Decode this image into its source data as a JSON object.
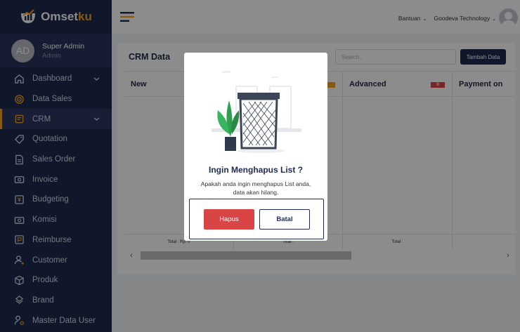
{
  "app": {
    "logo_text": "Omset",
    "logo_accent": "ku"
  },
  "profile": {
    "initials": "AD",
    "name": "Super Admin",
    "role": "Admin"
  },
  "sidebar": {
    "items": [
      {
        "label": "Dashboard",
        "icon": "home-icon",
        "has_chevron": true
      },
      {
        "label": "Data Sales",
        "icon": "target-icon",
        "has_chevron": false
      },
      {
        "label": "CRM",
        "icon": "clipboard-icon",
        "has_chevron": true,
        "active": true
      },
      {
        "label": "Quotation",
        "icon": "tag-icon",
        "has_chevron": false
      },
      {
        "label": "Sales Order",
        "icon": "document-icon",
        "has_chevron": false
      },
      {
        "label": "Invoice",
        "icon": "invoice-icon",
        "has_chevron": false
      },
      {
        "label": "Budgeting",
        "icon": "budget-icon",
        "has_chevron": false
      },
      {
        "label": "Komisi",
        "icon": "commission-icon",
        "has_chevron": false
      },
      {
        "label": "Reimburse",
        "icon": "reimburse-icon",
        "has_chevron": false
      },
      {
        "label": "Customer",
        "icon": "user-add-icon",
        "has_chevron": false
      },
      {
        "label": "Produk",
        "icon": "box-icon",
        "has_chevron": false
      },
      {
        "label": "Brand",
        "icon": "brand-icon",
        "has_chevron": false
      },
      {
        "label": "Master Data User",
        "icon": "user-settings-icon",
        "has_chevron": false
      }
    ]
  },
  "topbar": {
    "help_label": "Bantuan",
    "company_label": "Goodeva Technology"
  },
  "content": {
    "title": "CRM Data",
    "search_placeholder": "Search..",
    "add_button": "Tambah Data",
    "columns": [
      {
        "name": "New",
        "badge": "",
        "footer": "Total : Rp. 0",
        "badge_color": ""
      },
      {
        "name": "",
        "badge": "",
        "footer": "Total :",
        "badge_color": "#f5a524"
      },
      {
        "name": "Advanced",
        "badge": "0",
        "footer": "Total :",
        "badge_color": "#d94444"
      },
      {
        "name": "Payment on",
        "badge": "",
        "footer": "",
        "badge_color": ""
      }
    ]
  },
  "modal": {
    "title": "Ingin Menghapus List ?",
    "message": "Apakah anda ingin menghapus List anda, data akan hilang.",
    "confirm_label": "Hapus",
    "cancel_label": "Batal"
  },
  "colors": {
    "sidebar": "#1e2a4f",
    "accent": "#f5a524",
    "danger": "#d94444"
  }
}
